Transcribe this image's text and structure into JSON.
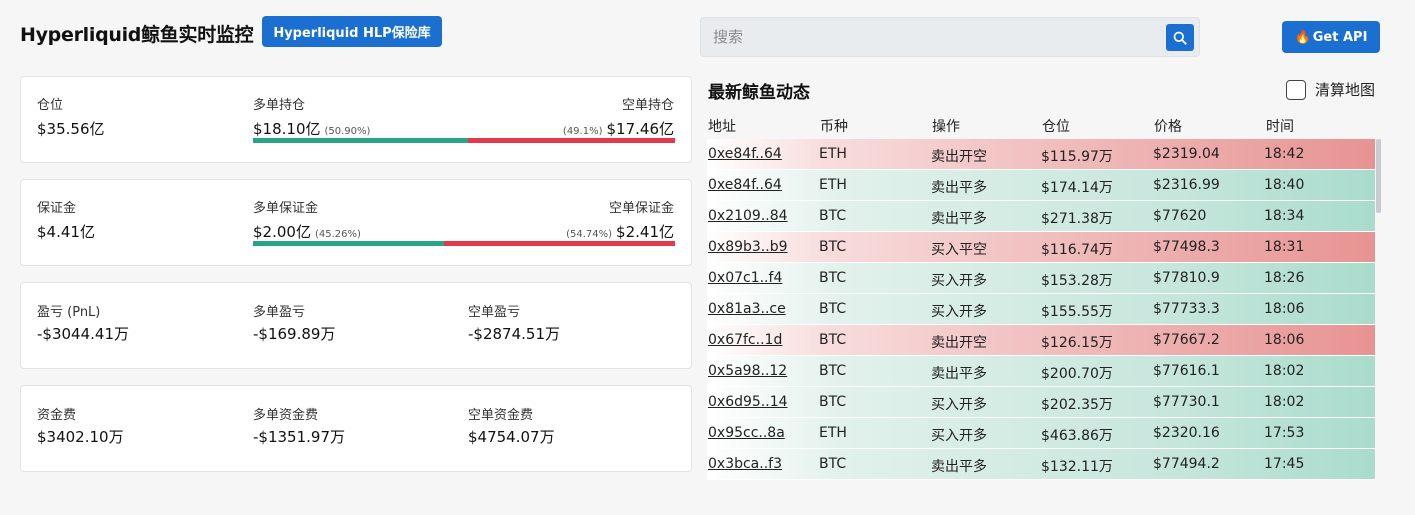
{
  "header": {
    "title": "Hyperliquid鲸鱼实时监控",
    "hlp_button": "Hyperliquid HLP保险库",
    "search_placeholder": "搜索",
    "api_button": "Get API",
    "api_icon": "flame-icon",
    "search_icon": "search-icon"
  },
  "colors": {
    "accent": "#1a6fd1",
    "long": "#27a58b",
    "short": "#e5384c"
  },
  "stats": {
    "position": {
      "total_label": "仓位",
      "total_value": "$35.56亿",
      "long_label": "多单持仓",
      "long_value": "$18.10亿",
      "long_pct": "(50.90%)",
      "short_label": "空单持仓",
      "short_value": "$17.46亿",
      "short_pct": "(49.1%)",
      "long_fraction": 0.509
    },
    "margin": {
      "total_label": "保证金",
      "total_value": "$4.41亿",
      "long_label": "多单保证金",
      "long_value": "$2.00亿",
      "long_pct": "(45.26%)",
      "short_label": "空单保证金",
      "short_value": "$2.41亿",
      "short_pct": "(54.74%)",
      "long_fraction": 0.4526
    },
    "pnl": {
      "total_label": "盈亏 (PnL)",
      "total_value": "-$3044.41万",
      "long_label": "多单盈亏",
      "long_value": "-$169.89万",
      "short_label": "空单盈亏",
      "short_value": "-$2874.51万"
    },
    "funding": {
      "total_label": "资金费",
      "total_value": "$3402.10万",
      "long_label": "多单资金费",
      "long_value": "-$1351.97万",
      "short_label": "空单资金费",
      "short_value": "$4754.07万"
    }
  },
  "feed": {
    "title": "最新鲸鱼动态",
    "heatmap_label": "清算地图",
    "columns": [
      "地址",
      "币种",
      "操作",
      "仓位",
      "价格",
      "时间"
    ],
    "rows": [
      {
        "addr": "0xe84f..64",
        "coin": "ETH",
        "action": "卖出开空",
        "size": "$115.97万",
        "price": "$2319.04",
        "time": "18:42",
        "side": "sell"
      },
      {
        "addr": "0xe84f..64",
        "coin": "ETH",
        "action": "卖出平多",
        "size": "$174.14万",
        "price": "$2316.99",
        "time": "18:40",
        "side": "buy"
      },
      {
        "addr": "0x2109..84",
        "coin": "BTC",
        "action": "卖出平多",
        "size": "$271.38万",
        "price": "$77620",
        "time": "18:34",
        "side": "buy"
      },
      {
        "addr": "0x89b3..b9",
        "coin": "BTC",
        "action": "买入平空",
        "size": "$116.74万",
        "price": "$77498.3",
        "time": "18:31",
        "side": "sell"
      },
      {
        "addr": "0x07c1..f4",
        "coin": "BTC",
        "action": "买入开多",
        "size": "$153.28万",
        "price": "$77810.9",
        "time": "18:26",
        "side": "buy"
      },
      {
        "addr": "0x81a3..ce",
        "coin": "BTC",
        "action": "买入开多",
        "size": "$155.55万",
        "price": "$77733.3",
        "time": "18:06",
        "side": "buy"
      },
      {
        "addr": "0x67fc..1d",
        "coin": "BTC",
        "action": "卖出开空",
        "size": "$126.15万",
        "price": "$77667.2",
        "time": "18:06",
        "side": "sell"
      },
      {
        "addr": "0x5a98..12",
        "coin": "BTC",
        "action": "卖出平多",
        "size": "$200.70万",
        "price": "$77616.1",
        "time": "18:02",
        "side": "buy"
      },
      {
        "addr": "0x6d95..14",
        "coin": "BTC",
        "action": "买入开多",
        "size": "$202.35万",
        "price": "$77730.1",
        "time": "18:02",
        "side": "buy"
      },
      {
        "addr": "0x95cc..8a",
        "coin": "ETH",
        "action": "买入开多",
        "size": "$463.86万",
        "price": "$2320.16",
        "time": "17:53",
        "side": "buy"
      },
      {
        "addr": "0x3bca..f3",
        "coin": "BTC",
        "action": "卖出平多",
        "size": "$132.11万",
        "price": "$77494.2",
        "time": "17:45",
        "side": "buy"
      }
    ]
  }
}
